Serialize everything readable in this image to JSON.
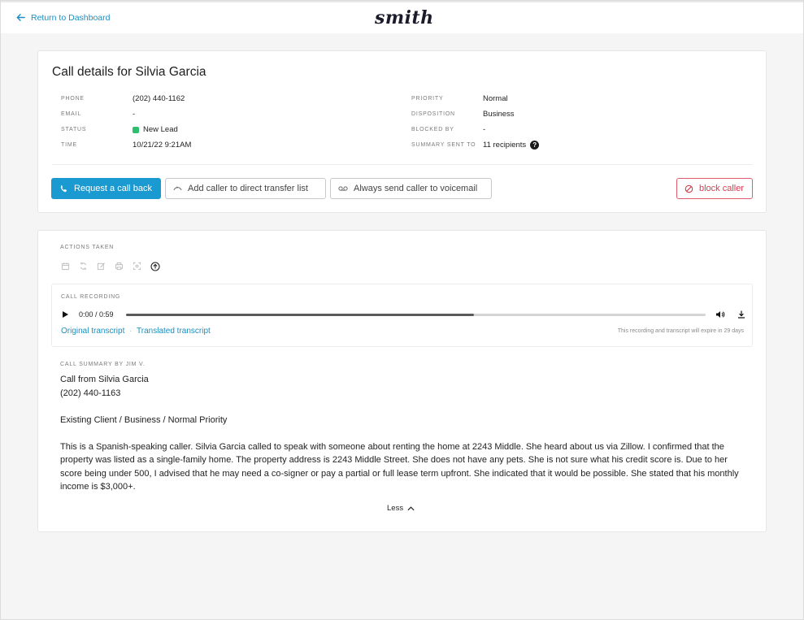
{
  "header": {
    "back_label": "Return to Dashboard",
    "logo_text": "smith"
  },
  "details": {
    "title": "Call details for Silvia Garcia",
    "left": [
      {
        "key": "PHONE",
        "value": "(202) 440-1162"
      },
      {
        "key": "EMAIL",
        "value": "-"
      },
      {
        "key": "STATUS",
        "value": "New Lead"
      },
      {
        "key": "TIME",
        "value": "10/21/22 9:21AM"
      }
    ],
    "right": [
      {
        "key": "PRIORITY",
        "value": "Normal"
      },
      {
        "key": "DISPOSITION",
        "value": "Business"
      },
      {
        "key": "BLOCKED BY",
        "value": "-"
      },
      {
        "key": "SUMMARY SENT TO",
        "value": "11 recipients"
      }
    ],
    "help_glyph": "?",
    "status_color": "#2dbf6e"
  },
  "buttons": {
    "callback": "Request a call back",
    "transfer": "Add caller to direct transfer list",
    "voicemail": "Always send caller to voicemail",
    "block": "block caller"
  },
  "actions": {
    "label": "ACTIONS TAKEN",
    "icons": [
      "calendar-icon",
      "sync-icon",
      "edit-icon",
      "print-icon",
      "scan-icon",
      "upload-circle-icon"
    ]
  },
  "recording": {
    "label": "CALL RECORDING",
    "time": "0:00 / 0:59",
    "progress_fraction": 0.6,
    "original_link": "Original transcript",
    "separator": "·",
    "translated_link": "Translated transcript",
    "expire_note": "This recording and transcript will expire in 29 days"
  },
  "summary": {
    "label": "CALL SUMMARY BY JIM V.",
    "line1": "Call from Silvia Garcia",
    "line2": "(202) 440-1163",
    "line3": "Existing Client / Business / Normal Priority",
    "body": "This is a Spanish-speaking caller. Silvia Garcia called to speak with someone about renting the home at 2243 Middle. She heard about us via Zillow. I confirmed that the property was listed as a single-family home. The property address is 2243 Middle Street. She does not have any pets. She is not sure what his credit score is. Due to her score being under 500, I advised that he may need a co-signer or pay a partial or full lease term upfront. She indicated that it would be possible. She stated that his monthly income is $3,000+.",
    "less_label": "Less"
  },
  "colors": {
    "accent": "#1a9ad1",
    "link": "#1a8fc1",
    "danger": "#d93a4e"
  }
}
